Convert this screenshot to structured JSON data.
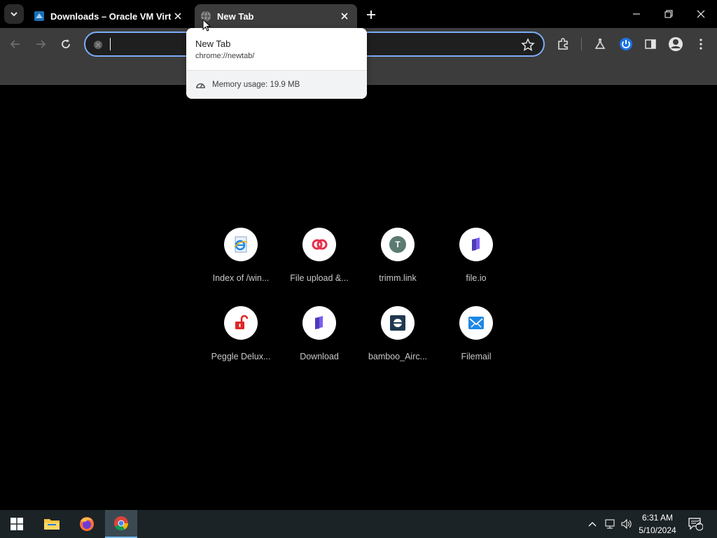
{
  "tabs": [
    {
      "title": "Downloads – Oracle VM Virtua",
      "favicon": "virtualbox-icon"
    },
    {
      "title": "New Tab",
      "favicon": "globe-icon"
    }
  ],
  "toolbar": {
    "omnibox_value": ""
  },
  "hovercard": {
    "title": "New Tab",
    "url": "chrome://newtab/",
    "memory": "Memory usage: 19.9 MB"
  },
  "shortcuts": [
    {
      "label": "Index of /win...",
      "icon": "ie-page-icon"
    },
    {
      "label": "File upload &...",
      "icon": "link-rings-icon"
    },
    {
      "label": "trimm.link",
      "icon": "letter-t-icon",
      "letter": "T"
    },
    {
      "label": "file.io",
      "icon": "fileio-icon"
    },
    {
      "label": "Peggle Delux...",
      "icon": "padlock-icon"
    },
    {
      "label": "Download",
      "icon": "fileio-icon"
    },
    {
      "label": "bamboo_Airc...",
      "icon": "bamboo-icon"
    },
    {
      "label": "Filemail",
      "icon": "filemail-icon"
    }
  ],
  "taskbar": {
    "time": "6:31 AM",
    "date": "5/10/2024",
    "notifications": "2"
  },
  "colors": {
    "accent": "#7cacf8",
    "toolbar": "#3c3c3c",
    "taskbar": "#1c2326"
  }
}
